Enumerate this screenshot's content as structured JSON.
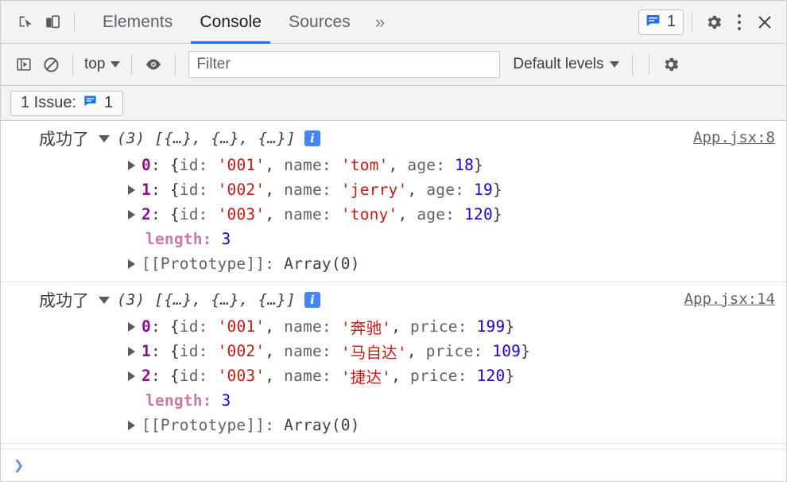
{
  "tabbar": {
    "inspect_icon": "inspect-cursor-icon",
    "device_icon": "device-toolbar-icon",
    "tabs": [
      {
        "label": "Elements",
        "active": false
      },
      {
        "label": "Console",
        "active": true
      },
      {
        "label": "Sources",
        "active": false
      }
    ],
    "more_tabs_glyph": "»",
    "issue_count": "1",
    "settings_icon": "gear-icon",
    "menu_icon": "kebab-menu-icon",
    "close_icon": "close-icon"
  },
  "console_toolbar": {
    "sidebar_icon": "console-sidebar-icon",
    "clear_icon": "clear-console-icon",
    "context": "top",
    "eye_icon": "live-expression-eye-icon",
    "filter_placeholder": "Filter",
    "filter_value": "",
    "levels_label": "Default levels",
    "settings_icon": "console-settings-gear-icon"
  },
  "issues_bar": {
    "text": "1 Issue:",
    "icon": "issue-message-icon",
    "count": "1"
  },
  "messages": [
    {
      "label": "成功了",
      "preview": "(3) [{…}, {…}, {…}]",
      "info_glyph": "i",
      "source": "App.jsx:8",
      "rows": [
        {
          "index": "0",
          "open": "{",
          "k1": "id:",
          "v1": "'001'",
          "k2": "name:",
          "v2": "'tom'",
          "k3": "age:",
          "v3": "18",
          "close": "}"
        },
        {
          "index": "1",
          "open": "{",
          "k1": "id:",
          "v1": "'002'",
          "k2": "name:",
          "v2": "'jerry'",
          "k3": "age:",
          "v3": "19",
          "close": "}"
        },
        {
          "index": "2",
          "open": "{",
          "k1": "id:",
          "v1": "'003'",
          "k2": "name:",
          "v2": "'tony'",
          "k3": "age:",
          "v3": "120",
          "close": "}"
        }
      ],
      "length_key": "length:",
      "length_value": "3",
      "prototype_key": "[[Prototype]]:",
      "prototype_value": "Array(0)"
    },
    {
      "label": "成功了",
      "preview": "(3) [{…}, {…}, {…}]",
      "info_glyph": "i",
      "source": "App.jsx:14",
      "rows": [
        {
          "index": "0",
          "open": "{",
          "k1": "id:",
          "v1": "'001'",
          "k2": "name:",
          "v2": "'奔驰'",
          "k3": "price:",
          "v3": "199",
          "close": "}"
        },
        {
          "index": "1",
          "open": "{",
          "k1": "id:",
          "v1": "'002'",
          "k2": "name:",
          "v2": "'马自达'",
          "k3": "price:",
          "v3": "109",
          "close": "}"
        },
        {
          "index": "2",
          "open": "{",
          "k1": "id:",
          "v1": "'003'",
          "k2": "name:",
          "v2": "'捷达'",
          "k3": "price:",
          "v3": "120",
          "close": "}"
        }
      ],
      "length_key": "length:",
      "length_value": "3",
      "prototype_key": "[[Prototype]]:",
      "prototype_value": "Array(0)"
    }
  ],
  "prompt": {
    "chevron": "❯"
  },
  "colors": {
    "accent": "#1a73e8",
    "string": "#c41a16",
    "number": "#1c00cf",
    "index": "#881391",
    "length_key": "#c779a8",
    "toolbar_bg": "#f3f3f3"
  }
}
